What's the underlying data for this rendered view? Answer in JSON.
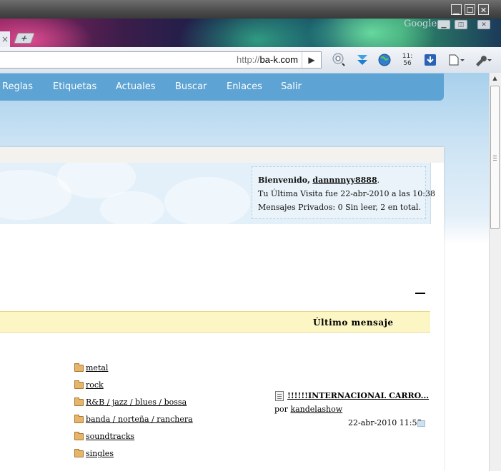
{
  "browser": {
    "google_label": "Google",
    "tab_close": "×",
    "new_tab": "+",
    "url_protocol": "http://",
    "url_host": "ba-k.com",
    "go_symbol": "▶",
    "clock": "11:\n56",
    "window_buttons": [
      "▁",
      "☐",
      "✕"
    ]
  },
  "nav": {
    "items": [
      "Reglas",
      "Etiquetas",
      "Actuales",
      "Buscar",
      "Enlaces",
      "Salir"
    ],
    "color": "#5da3d3"
  },
  "welcome": {
    "greeting": "Bienvenido,",
    "username": "dannnnyy8888",
    "greeting_end": ".",
    "last_visit": "Tu Última Visita fue 22-abr-2010 a las 10:38",
    "private_messages": "Mensajes Privados: 0 Sin leer, 2 en total."
  },
  "forum": {
    "column_header": "Último mensaje",
    "header_color": "#fcf6c4",
    "subforums": [
      "metal",
      "rock",
      "R&B / jazz / blues / bossa",
      "banda / norteña / ranchera",
      "soundtracks",
      "singles"
    ],
    "last_post": {
      "title": "!!!!!!INTERNACIONAL CARRO...",
      "by_label": "por",
      "author": "kandelashow",
      "date": "22-abr-2010 11:55"
    }
  }
}
